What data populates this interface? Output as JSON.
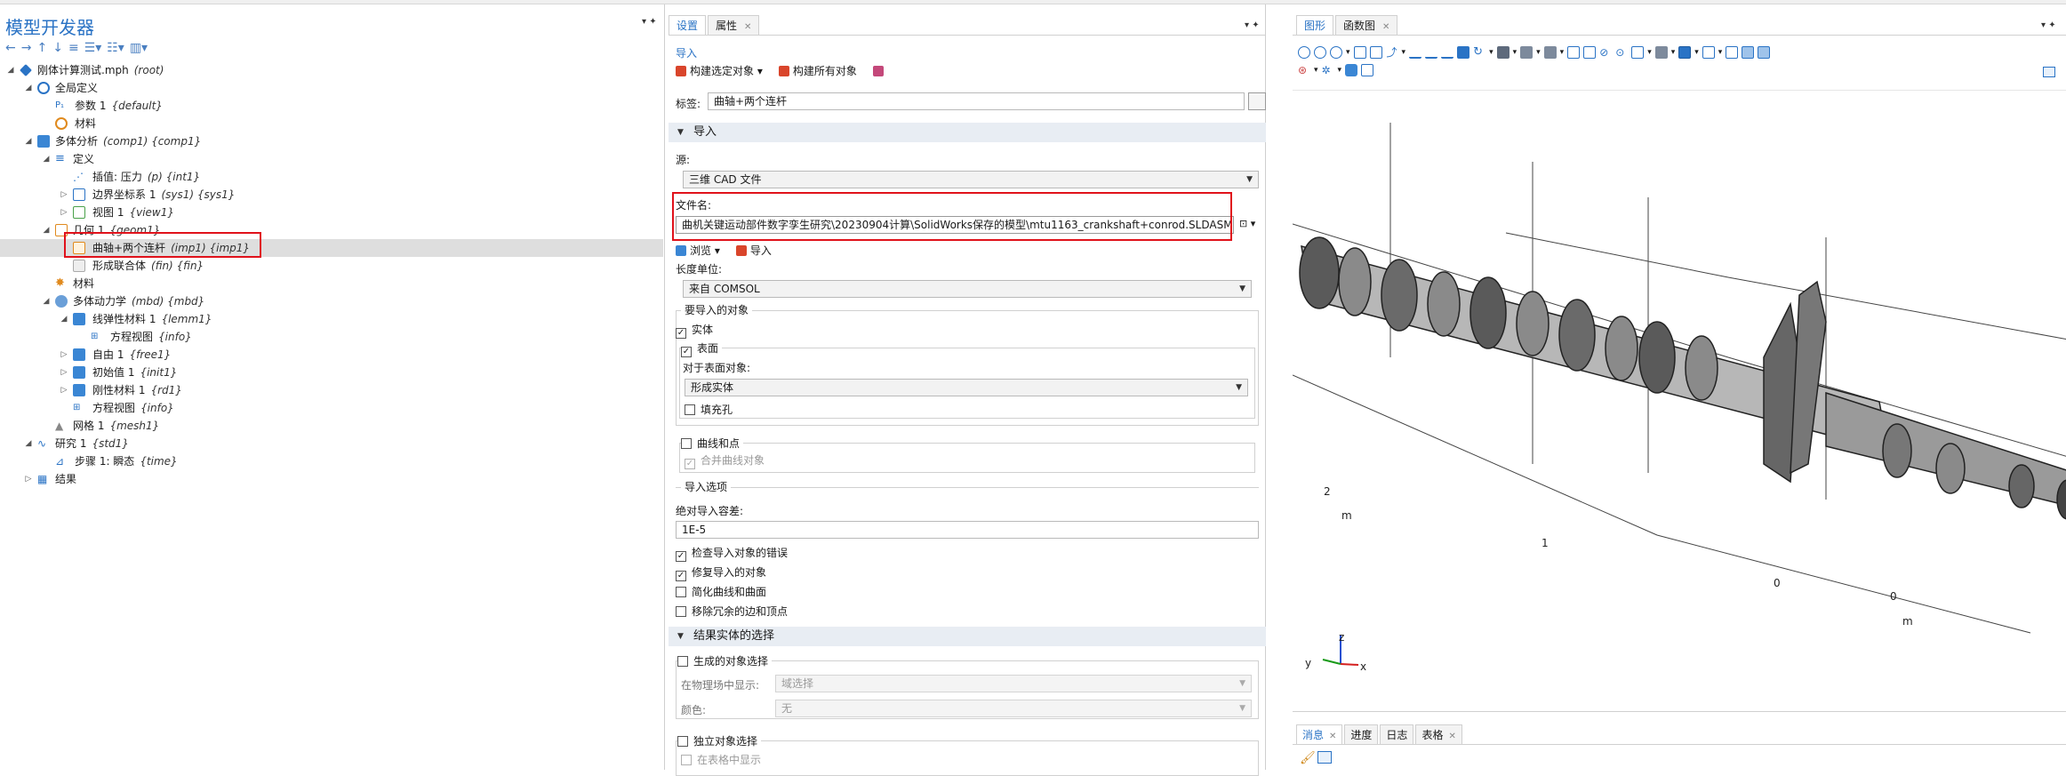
{
  "colors": {
    "accent": "#2a73c5",
    "highlight": "#e0121b",
    "section": "#e8edf3"
  },
  "builder": {
    "title": "模型开发器",
    "tree": [
      {
        "label": "刚体计算测试.mph",
        "tag": "(root)"
      },
      {
        "label": "全局定义",
        "tag": ""
      },
      {
        "label": "参数 1",
        "tag": "{default}"
      },
      {
        "label": "材料",
        "tag": ""
      },
      {
        "label": "多体分析",
        "tag": "(comp1) {comp1}"
      },
      {
        "label": "定义",
        "tag": ""
      },
      {
        "label": "插值: 压力",
        "tag": "(p) {int1}"
      },
      {
        "label": "边界坐标系 1",
        "tag": "(sys1) {sys1}"
      },
      {
        "label": "视图 1",
        "tag": "{view1}"
      },
      {
        "label": "几何 1",
        "tag": "{geom1}"
      },
      {
        "label": "曲轴+两个连杆",
        "tag": "(imp1) {imp1}"
      },
      {
        "label": "形成联合体",
        "tag": "(fin) {fin}"
      },
      {
        "label": "材料",
        "tag": ""
      },
      {
        "label": "多体动力学",
        "tag": "(mbd) {mbd}"
      },
      {
        "label": "线弹性材料 1",
        "tag": "{lemm1}"
      },
      {
        "label": "方程视图",
        "tag": "{info}"
      },
      {
        "label": "自由 1",
        "tag": "{free1}"
      },
      {
        "label": "初始值 1",
        "tag": "{init1}"
      },
      {
        "label": "刚性材料 1",
        "tag": "{rd1}"
      },
      {
        "label": "方程视图",
        "tag": "{info}"
      },
      {
        "label": "网格 1",
        "tag": "{mesh1}"
      },
      {
        "label": "研究 1",
        "tag": "{std1}"
      },
      {
        "label": "步骤 1: 瞬态",
        "tag": "{time}"
      },
      {
        "label": "结果",
        "tag": ""
      }
    ]
  },
  "settings": {
    "tabs": [
      "设置",
      "属性"
    ],
    "heading": "导入",
    "build_selected": "构建选定对象",
    "build_all": "构建所有对象",
    "label_caption": "标签:",
    "label_value": "曲轴+两个连杆",
    "section_import": "导入",
    "source_caption": "源:",
    "source_value": "三维 CAD 文件",
    "filename_caption": "文件名:",
    "filename_value": "曲机关键运动部件数字孪生研究\\20230904计算\\SolidWorks保存的模型\\mtu1163_crankshaft+conrod.SLDASM",
    "browse": "浏览",
    "import_btn": "导入",
    "length_unit_caption": "长度单位:",
    "length_unit_value": "来自 COMSOL",
    "objects_group": "要导入的对象",
    "solids": "实体",
    "surfaces": "表面",
    "for_surfaces": "对于表面对象:",
    "for_surfaces_value": "形成实体",
    "fill_holes": "填充孔",
    "curves_points": "曲线和点",
    "merge_curves": "合并曲线对象",
    "import_options": "导入选项",
    "abs_tol_caption": "绝对导入容差:",
    "abs_tol_value": "1E-5",
    "check_errors": "检查导入对象的错误",
    "repair": "修复导入的对象",
    "simplify": "简化曲线和曲面",
    "remove_redundant": "移除冗余的边和顶点",
    "section_selection": "结果实体的选择",
    "resulting_selection": "生成的对象选择",
    "show_in_physics": "在物理场中显示:",
    "show_in_physics_value": "域选择",
    "color_caption": "颜色:",
    "color_value": "无",
    "separate_selection": "独立对象选择",
    "show_in_table": "在表格中显示"
  },
  "graphics": {
    "tabs": [
      "图形",
      "函数图"
    ],
    "axis_labels": {
      "a": "2",
      "b": "m",
      "c": "1",
      "d": "0",
      "e": "0",
      "f": "m"
    },
    "triad": {
      "z": "z",
      "y": "y",
      "x": "x"
    },
    "bottom_tabs": [
      "消息",
      "进度",
      "日志",
      "表格"
    ]
  }
}
